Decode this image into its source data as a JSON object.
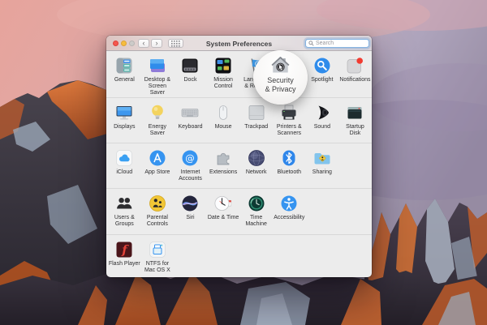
{
  "colors": {
    "window_bg": "#ececec",
    "accent_blue": "#3694f0",
    "search_border": "#84b3e2",
    "badge_red": "#f23b30",
    "sky_pink": "#e7a49c",
    "sky_purple": "#968ba2",
    "rock_orange": "#d0682f"
  },
  "window": {
    "title": "System Preferences",
    "toolbar": {
      "back": "‹",
      "forward": "›"
    },
    "search": {
      "placeholder": "Search"
    }
  },
  "magnifier": {
    "target": "Security & Privacy",
    "icon": "security-privacy",
    "lines": [
      "Security",
      "& Privacy"
    ]
  },
  "grid": {
    "rows": [
      {
        "items": [
          {
            "icon": "general",
            "lines": [
              "General"
            ]
          },
          {
            "icon": "desktop-screen-saver",
            "lines": [
              "Desktop &",
              "Screen Saver"
            ]
          },
          {
            "icon": "dock",
            "lines": [
              "Dock"
            ]
          },
          {
            "icon": "mission-control",
            "lines": [
              "Mission",
              "Control"
            ]
          },
          {
            "icon": "language-region",
            "lines": [
              "Language",
              "& Region"
            ]
          },
          {
            "icon": "security-privacy",
            "lines": [
              "Security",
              "& Privacy"
            ]
          },
          {
            "icon": "spotlight",
            "lines": [
              "Spotlight"
            ]
          },
          {
            "icon": "notifications",
            "lines": [
              "Notifications"
            ]
          }
        ]
      },
      {
        "items": [
          {
            "icon": "displays",
            "lines": [
              "Displays"
            ]
          },
          {
            "icon": "energy-saver",
            "lines": [
              "Energy",
              "Saver"
            ]
          },
          {
            "icon": "keyboard",
            "lines": [
              "Keyboard"
            ]
          },
          {
            "icon": "mouse",
            "lines": [
              "Mouse"
            ]
          },
          {
            "icon": "trackpad",
            "lines": [
              "Trackpad"
            ]
          },
          {
            "icon": "printers-scanners",
            "lines": [
              "Printers &",
              "Scanners"
            ]
          },
          {
            "icon": "sound",
            "lines": [
              "Sound"
            ]
          },
          {
            "icon": "startup-disk",
            "lines": [
              "Startup",
              "Disk"
            ]
          }
        ]
      },
      {
        "items": [
          {
            "icon": "icloud",
            "lines": [
              "iCloud"
            ]
          },
          {
            "icon": "app-store",
            "lines": [
              "App Store"
            ]
          },
          {
            "icon": "internet-accounts",
            "lines": [
              "Internet",
              "Accounts"
            ]
          },
          {
            "icon": "extensions",
            "lines": [
              "Extensions"
            ]
          },
          {
            "icon": "network",
            "lines": [
              "Network"
            ]
          },
          {
            "icon": "bluetooth",
            "lines": [
              "Bluetooth"
            ]
          },
          {
            "icon": "sharing",
            "lines": [
              "Sharing"
            ]
          }
        ]
      },
      {
        "items": [
          {
            "icon": "users-groups",
            "lines": [
              "Users &",
              "Groups"
            ]
          },
          {
            "icon": "parental-controls",
            "lines": [
              "Parental",
              "Controls"
            ]
          },
          {
            "icon": "siri",
            "lines": [
              "Siri"
            ]
          },
          {
            "icon": "date-time",
            "lines": [
              "Date & Time"
            ]
          },
          {
            "icon": "time-machine",
            "lines": [
              "Time",
              "Machine"
            ]
          },
          {
            "icon": "accessibility",
            "lines": [
              "Accessibility"
            ]
          }
        ]
      },
      {
        "items": [
          {
            "icon": "flash-player",
            "lines": [
              "Flash Player"
            ]
          },
          {
            "icon": "ntfs",
            "lines": [
              "NTFS for",
              "Mac OS X"
            ]
          }
        ]
      }
    ]
  }
}
